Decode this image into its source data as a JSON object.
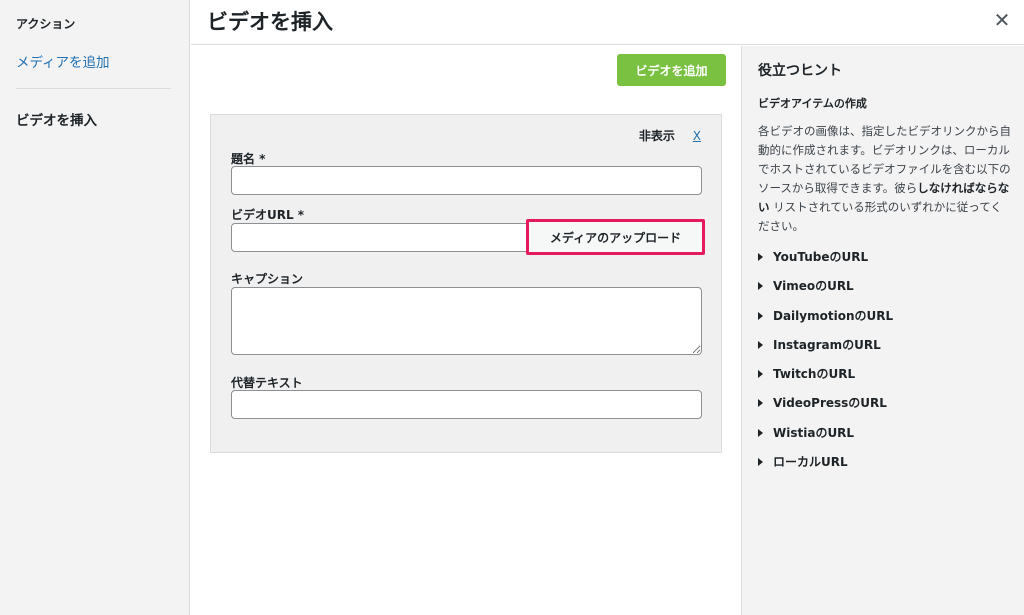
{
  "sidebar": {
    "section_title": "アクション",
    "add_media": "メディアを追加",
    "current_item": "ビデオを挿入"
  },
  "header": {
    "title": "ビデオを挿入",
    "close_glyph": "✕"
  },
  "main": {
    "add_video_button": "ビデオを追加",
    "hide_label": "非表示",
    "hide_x": "X",
    "fields": {
      "title_label": "題名 *",
      "title_value": "",
      "video_url_label": "ビデオURL *",
      "video_url_value": "",
      "upload_button": "メディアのアップロード",
      "caption_label": "キャプション",
      "caption_value": "",
      "alt_label": "代替テキスト",
      "alt_value": ""
    }
  },
  "tips": {
    "title": "役立つヒント",
    "subtitle": "ビデオアイテムの作成",
    "desc_part1": "各ビデオの画像は、指定したビデオリンクから自動的に作成されます。ビデオリンクは、ローカルでホストされているビデオファイルを含む以下のソースから取得できます。彼ら",
    "desc_bold": "しなければならない",
    "desc_part2": " リストされている形式のいずれかに従ってください。",
    "sources": [
      "YouTubeのURL",
      "VimeoのURL",
      "DailymotionのURL",
      "InstagramのURL",
      "TwitchのURL",
      "VideoPressのURL",
      "WistiaのURL",
      "ローカルURL"
    ]
  },
  "colors": {
    "accent_green": "#7ac142",
    "link_blue": "#2271b1",
    "highlight_pink": "#e5195e"
  }
}
